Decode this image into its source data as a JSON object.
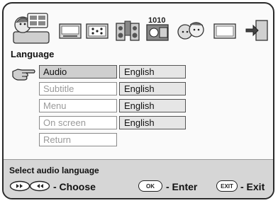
{
  "menu": {
    "section_title": "Language",
    "items": [
      {
        "label": "Audio",
        "value": "English",
        "active": true
      },
      {
        "label": "Subtitle",
        "value": "English",
        "active": false
      },
      {
        "label": "Menu",
        "value": "English",
        "active": false
      },
      {
        "label": "On screen",
        "value": "English",
        "active": false
      },
      {
        "label": "Return",
        "value": "",
        "active": false
      }
    ]
  },
  "toolbar": {
    "icons": [
      "language-settings-icon",
      "screen-icon",
      "dots-screen-icon",
      "speakers-icon",
      "binary-icon",
      "parental-faces-icon",
      "display-icon",
      "exit-door-icon"
    ]
  },
  "footer": {
    "hint": "Select audio language",
    "choose_label": "- Choose",
    "enter_label": "- Enter",
    "exit_label": "- Exit",
    "ok_text": "OK",
    "exit_text": "EXIT"
  }
}
